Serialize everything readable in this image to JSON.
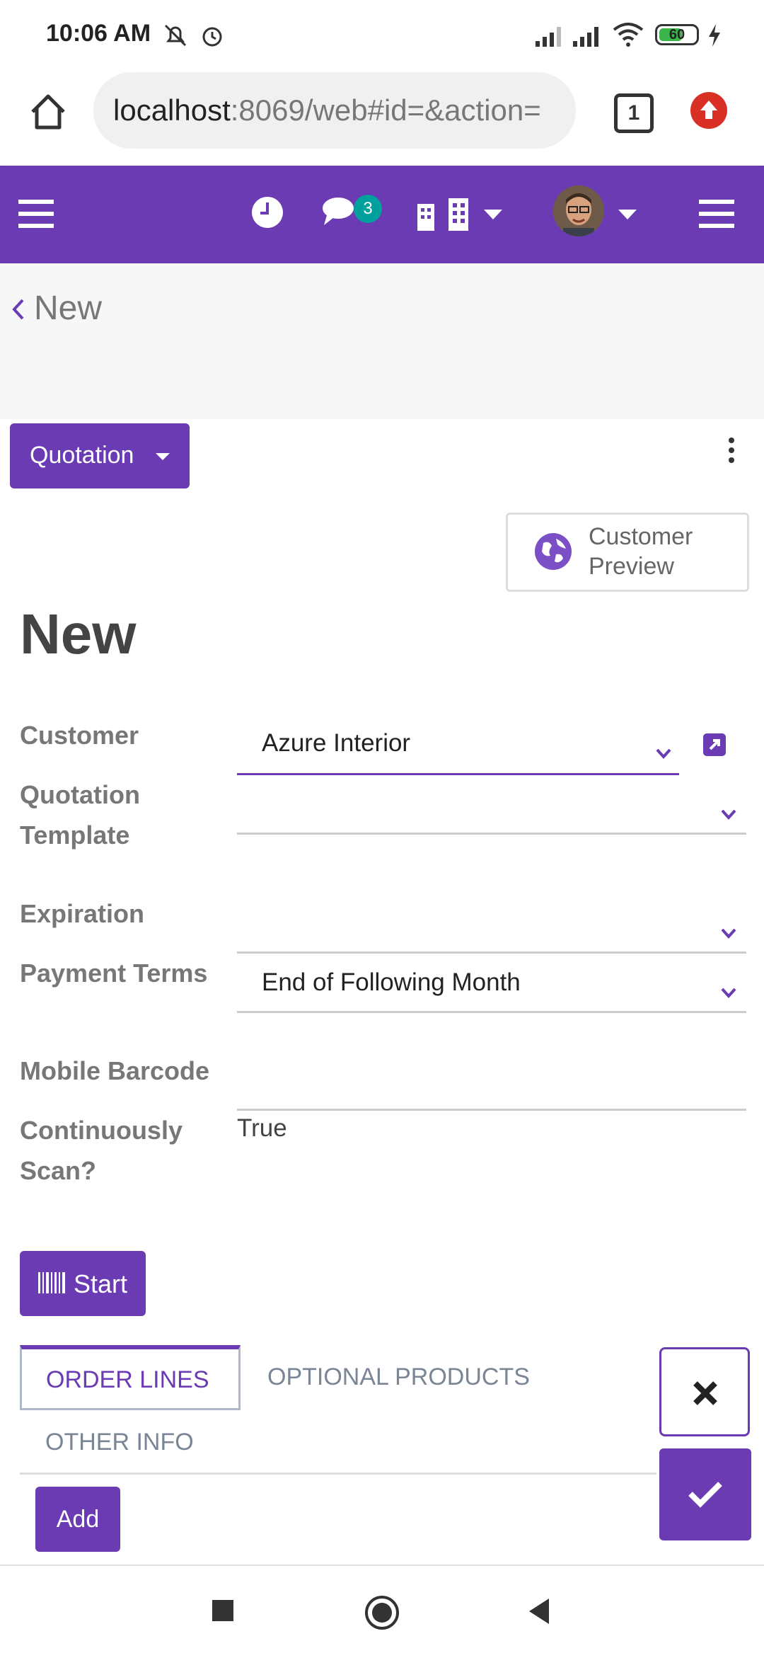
{
  "status_bar": {
    "time": "10:06 AM",
    "battery": "60",
    "icons": [
      "mute-icon",
      "alarm-icon",
      "signal-icon",
      "signal-icon",
      "wifi-icon",
      "battery-icon",
      "charging-icon"
    ]
  },
  "browser": {
    "url_host": "localhost",
    "url_rest": ":8069/web#id=&action=",
    "tab_count": "1"
  },
  "navbar": {
    "messages_badge": "3",
    "icons": [
      "menu-icon",
      "clock-icon",
      "chat-icon",
      "building-icon",
      "avatar",
      "menu-icon"
    ]
  },
  "breadcrumb": {
    "label": "New"
  },
  "status_button": {
    "label": "Quotation"
  },
  "preview_button": {
    "line1": "Customer",
    "line2": "Preview"
  },
  "record": {
    "title": "New"
  },
  "fields": {
    "customer": {
      "label": "Customer",
      "value": "Azure Interior"
    },
    "template": {
      "label1": "Quotation",
      "label2": "Template",
      "value": ""
    },
    "expiration": {
      "label": "Expiration",
      "value": ""
    },
    "payment_terms": {
      "label": "Payment Terms",
      "value": "End of Following Month"
    },
    "mobile_barcode": {
      "label": "Mobile Barcode",
      "value": ""
    },
    "continuous_scan": {
      "label1": "Continuously",
      "label2": "Scan?",
      "value": "True"
    }
  },
  "start_button": {
    "label": "Start"
  },
  "tabs": [
    {
      "label": "ORDER LINES"
    },
    {
      "label": "OPTIONAL PRODUCTS"
    },
    {
      "label": "OTHER INFO"
    }
  ],
  "add_button": {
    "label": "Add"
  },
  "colors": {
    "primary": "#6a3bb2",
    "badge": "#00a09d",
    "update": "#d93025"
  }
}
